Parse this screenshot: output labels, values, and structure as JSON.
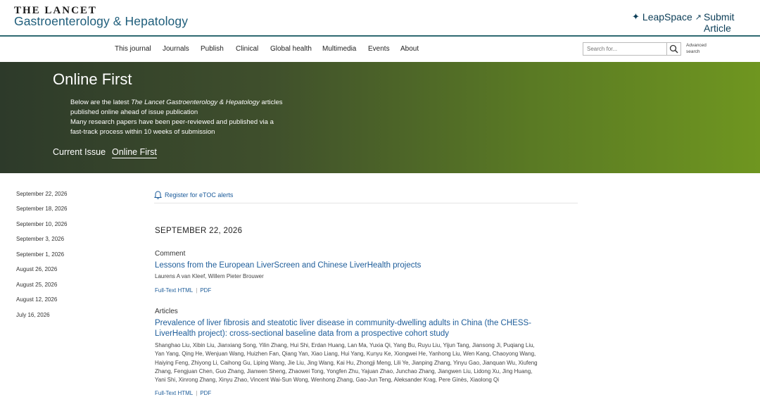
{
  "header": {
    "logo_line1": "THE LANCET",
    "logo_line2": "Gastroenterology & Hepatology",
    "leapspace": "LeapSpace",
    "submit": "Submit Article"
  },
  "nav": {
    "items": [
      "This journal",
      "Journals",
      "Publish",
      "Clinical",
      "Global health",
      "Multimedia",
      "Events",
      "About"
    ],
    "search_placeholder": "Search for...",
    "advanced_search": "Advanced search"
  },
  "banner": {
    "title": "Online First",
    "desc_part1": "Below are the latest ",
    "desc_journal": "The Lancet Gastroenterology & Hepatology",
    "desc_part2": " articles published online ahead of issue publication",
    "desc_line2": "Many research papers have been peer-reviewed and published via a fast-track process within 10 weeks of submission",
    "tabs": [
      "Current Issue",
      "Online First"
    ]
  },
  "sidebar": {
    "dates": [
      "September 22, 2026",
      "September 18, 2026",
      "September 10, 2026",
      "September 3, 2026",
      "September 1, 2026",
      "August 26, 2026",
      "August 25, 2026",
      "August 12, 2026",
      "July 16, 2026"
    ]
  },
  "main": {
    "register": "Register for eTOC alerts",
    "issue_date": "SEPTEMBER 22, 2026",
    "articles": [
      {
        "type": "Comment",
        "title": "Lessons from the European LiverScreen and Chinese LiverHealth projects",
        "authors": "Laurens A van Kleef, Willem Pieter Brouwer",
        "full_text": "Full-Text HTML",
        "pdf": "PDF"
      },
      {
        "type": "Articles",
        "title": "Prevalence of liver fibrosis and steatotic liver disease in community-dwelling adults in China (the CHESS-LiverHealth project): cross-sectional baseline data from a prospective cohort study",
        "authors": "Shanghao Liu, Xibin Liu, Jianxiang Song, Yilin Zhang, Hui Shi, Erdan Huang, Lan Ma, Yuxia Qi, Yang Bu, Ruyu Liu, Yijun Tang, Jiansong Ji, Puqiang Liu, Yan Yang, Qing He, Wenjuan Wang, Huizhen Fan, Qiang Yan, Xiao Liang, Hui Yang, Kunyu Ke, Xiongwei He, Yanhong Liu, Wen Kang, Chaoyong Wang, Haiying Feng, Zhiyong Li, Caihong Gu, Liping Wang, Jie Liu, Jing Wang, Kai Hu, Zhongji Meng, Lili Ye, Jianping Zhang, Yinyu Gao, Jianquan Wu, Xiufeng Zhang, Fengjuan Chen, Guo Zhang, Jianwen Sheng, Zhaowei Tong, Yongfen Zhu, Yajuan Zhao, Junchao Zhang, Jiangwen Liu, Lidong Xu, Jing Huang, Yani Shi, Xinrong Zhang, Xinyu Zhao, Vincent Wai-Sun Wong, Wenhong Zhang, Gao-Jun Teng, Aleksander Krag, Pere Ginès, Xiaolong Qi",
        "full_text": "Full-Text HTML",
        "pdf": "PDF"
      }
    ]
  }
}
